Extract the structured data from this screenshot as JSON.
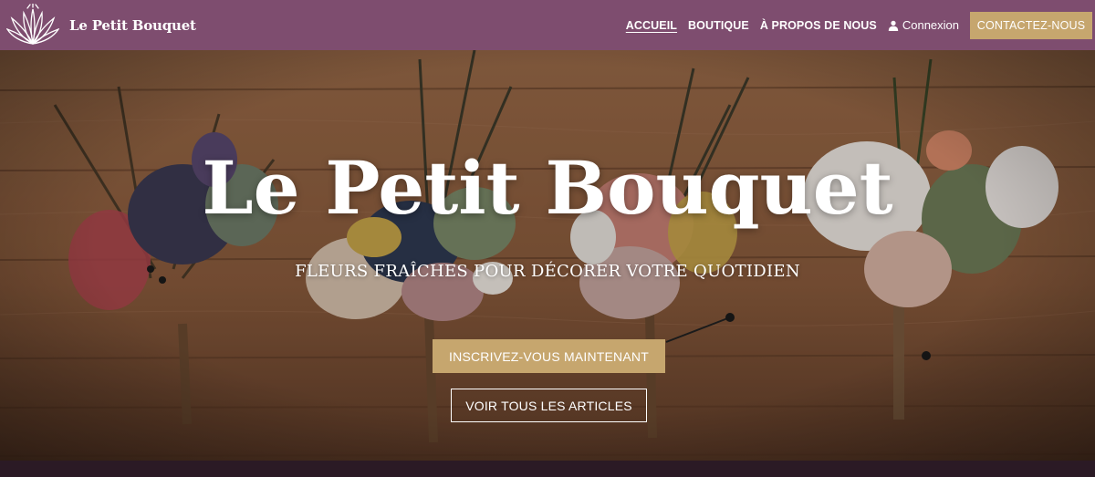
{
  "nav": {
    "brand": "Le Petit Bouquet",
    "logo_icon": "lotus-flower-logo-icon",
    "links": [
      {
        "label": "ACCUEIL",
        "active": true
      },
      {
        "label": "BOUTIQUE",
        "active": false
      },
      {
        "label": "À PROPOS DE NOUS",
        "active": false
      }
    ],
    "login": {
      "label": "Connexion",
      "icon": "user-icon"
    },
    "contact_button": "CONTACTEZ-NOUS"
  },
  "hero": {
    "title": "Le Petit Bouquet",
    "subtitle": "FLEURS FRAÎCHES POUR DÉCORER VOTRE QUOTIDIEN",
    "primary_button": "INSCRIVEZ-VOUS MAINTENANT",
    "secondary_button": "VOIR TOUS LES ARTICLES"
  },
  "colors": {
    "nav_background": "#7e4d6f",
    "accent_gold": "#c6a66e",
    "text_light": "#ffffff"
  }
}
